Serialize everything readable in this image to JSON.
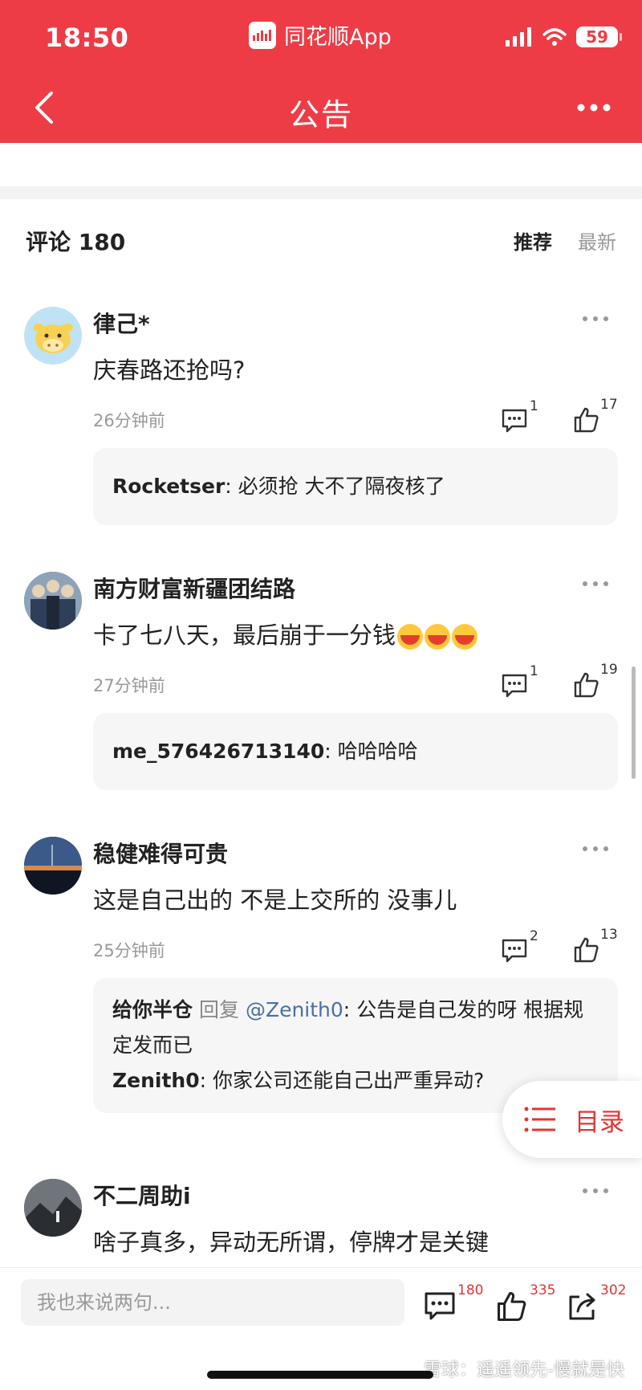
{
  "status_bar": {
    "time": "18:50",
    "app_label": "同花顺App",
    "battery": "59"
  },
  "nav": {
    "title": "公告"
  },
  "comments_header": {
    "title": "评论 180",
    "tabs": [
      "推荐",
      "最新"
    ],
    "active_tab": "推荐"
  },
  "comments": [
    {
      "user": "律己*",
      "text": "庆春路还抢吗?",
      "time": "26分钟前",
      "reply_count": "1",
      "like_count": "17",
      "replies": [
        {
          "user": "Rocketser",
          "sep": ":",
          "text": "必须抢 大不了隔夜核了"
        }
      ]
    },
    {
      "user": "南方财富新疆团结路",
      "text": "卡了七八天，最后崩于一分钱",
      "time": "27分钟前",
      "reply_count": "1",
      "like_count": "19",
      "replies": [
        {
          "user": "me_576426713140",
          "sep": ":",
          "text": "哈哈哈哈"
        }
      ]
    },
    {
      "user": "稳健难得可贵",
      "text": "这是自己出的 不是上交所的 没事儿",
      "time": "25分钟前",
      "reply_count": "2",
      "like_count": "13",
      "replies": [
        {
          "user": "给你半仓",
          "reply_word": "回复",
          "mention": "@Zenith0",
          "sep": ":",
          "text": "公告是自己发的呀 根据规定发而已"
        },
        {
          "user": "Zenith0",
          "sep": ":",
          "text": "你家公司还能自己出严重异动?"
        }
      ]
    },
    {
      "user": "不二周助i",
      "text": "啥子真多，异动无所谓，停牌才是关键"
    }
  ],
  "toc_button": {
    "label": "目录"
  },
  "bottom_bar": {
    "placeholder": "我也来说两句...",
    "comment_count": "180",
    "like_count": "335",
    "share_count": "302"
  },
  "watermark": "雪球：遥遥领先-慢就是快",
  "colors": {
    "brand_red": "#ed3c45",
    "link_blue": "#4a6fa5",
    "accent_red": "#e03636"
  }
}
